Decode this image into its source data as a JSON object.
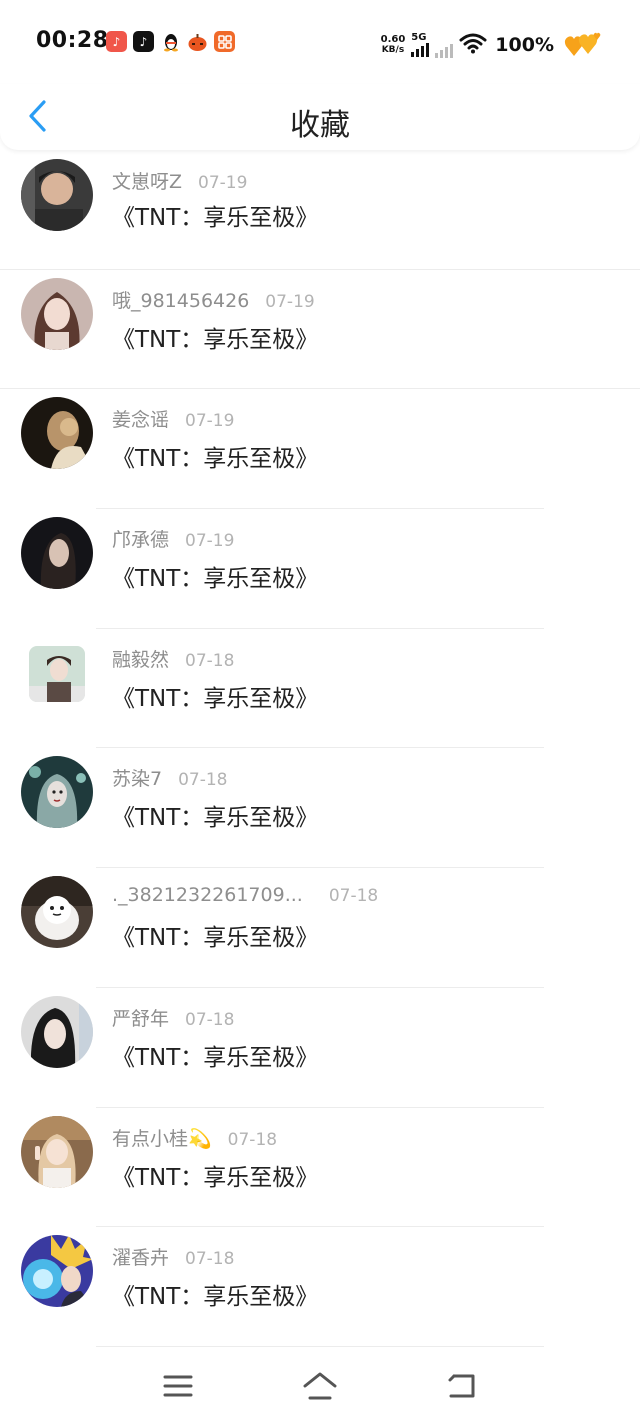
{
  "status": {
    "time": "00:28",
    "net_speed_value": "0.60",
    "net_speed_unit": "KB/s",
    "network": "5G",
    "battery": "100%",
    "app_icons": [
      "douyin-red-icon",
      "tiktok-icon",
      "qq-penguin-icon",
      "pumpkin-icon",
      "orange-app-icon"
    ]
  },
  "header": {
    "title": "收藏",
    "back_icon": "chevron-left-icon",
    "accent": "#2a9df4"
  },
  "items": [
    {
      "user": "文崽呀Z",
      "date": "07-19",
      "title": "《TNT：享乐至极》"
    },
    {
      "user": "哦_981456426",
      "date": "07-19",
      "title": "《TNT：享乐至极》"
    },
    {
      "user": "姜念谣",
      "date": "07-19",
      "title": "《TNT：享乐至极》"
    },
    {
      "user": "邝承德",
      "date": "07-19",
      "title": "《TNT：享乐至极》"
    },
    {
      "user": "融毅然",
      "date": "07-18",
      "title": "《TNT：享乐至极》"
    },
    {
      "user": "苏染7",
      "date": "07-18",
      "title": "《TNT：享乐至极》"
    },
    {
      "user": "._3821232261709...",
      "date": "07-18",
      "title": "《TNT：享乐至极》"
    },
    {
      "user": "严舒年",
      "date": "07-18",
      "title": "《TNT：享乐至极》"
    },
    {
      "user": "有点小桂💫",
      "date": "07-18",
      "title": "《TNT：享乐至极》"
    },
    {
      "user": "濯香卉",
      "date": "07-18",
      "title": "《TNT：享乐至极》"
    }
  ],
  "nav": {
    "menu_icon": "menu-icon",
    "home_icon": "home-icon",
    "back_icon": "back-arrow-icon"
  }
}
